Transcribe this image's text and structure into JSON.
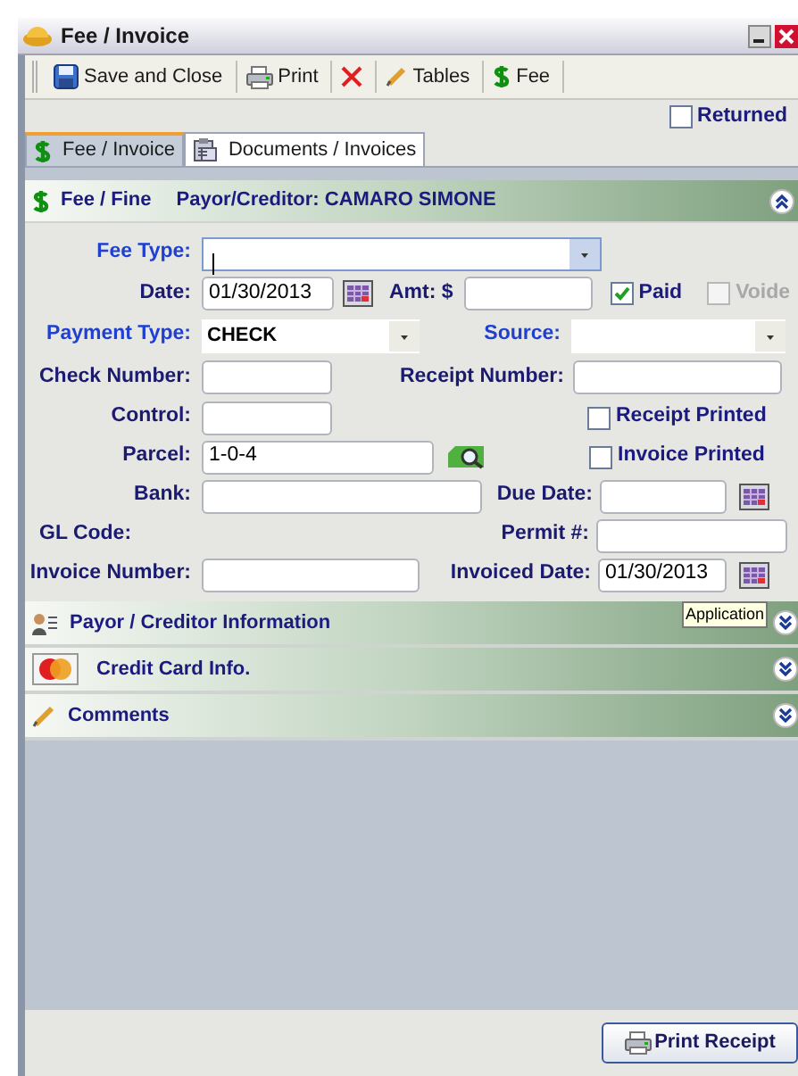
{
  "window": {
    "title": "Fee / Invoice"
  },
  "toolbar": [
    {
      "kind": "save",
      "label": "Save and Close"
    },
    {
      "kind": "print",
      "label": "Print"
    },
    {
      "kind": "delete"
    },
    {
      "kind": "tables",
      "label": "Tables"
    },
    {
      "kind": "fee",
      "label": "Fee"
    }
  ],
  "returned": {
    "label": "Returned",
    "checked": false
  },
  "tabs": [
    {
      "kind": "fee",
      "label": "Fee / Invoice",
      "selected": true
    },
    {
      "kind": "documents",
      "label": "Documents / Invoices",
      "selected": false
    }
  ],
  "section": {
    "title": "Fee / Fine",
    "payor": "Payor/Creditor: CAMARO SIMONE",
    "expanded": true
  },
  "form": {
    "fee_type": {
      "label": "Fee Type:",
      "required": true,
      "focused": true
    },
    "date": {
      "label": "Date:",
      "value": "01/30/2013"
    },
    "amount": {
      "label": "Amt: $"
    },
    "paid": {
      "label": "Paid",
      "checked": true
    },
    "voided": {
      "label": "Voide",
      "checked": false,
      "disabled": true
    },
    "payment_type": {
      "label": "Payment Type:",
      "value": "CHECK",
      "required": true
    },
    "source": {
      "label": "Source:",
      "required": true
    },
    "check_number": {
      "label": "Check Number:"
    },
    "receipt_number": {
      "label": "Receipt Number:"
    },
    "control": {
      "label": "Control:"
    },
    "receipt_printed": {
      "label": "Receipt Printed",
      "checked": false
    },
    "parcel": {
      "label": "Parcel:",
      "value": "1-0-4"
    },
    "invoice_printed": {
      "label": "Invoice Printed",
      "checked": false
    },
    "bank": {
      "label": "Bank:"
    },
    "due_date": {
      "label": "Due Date:"
    },
    "gl_code": {
      "label": "GL Code:"
    },
    "permit": {
      "label": "Permit #:"
    },
    "invoice_number": {
      "label": "Invoice Number:"
    },
    "invoiced_date": {
      "label": "Invoiced Date:",
      "value": "01/30/2013"
    }
  },
  "panels": [
    {
      "kind": "payor",
      "title": "Payor / Creditor Information",
      "expanded": false
    },
    {
      "kind": "card",
      "title": "Credit Card Info.",
      "expanded": false
    },
    {
      "kind": "comments",
      "title": "Comments",
      "expanded": false
    }
  ],
  "tooltip": "Application",
  "print_receipt": "Print Receipt"
}
